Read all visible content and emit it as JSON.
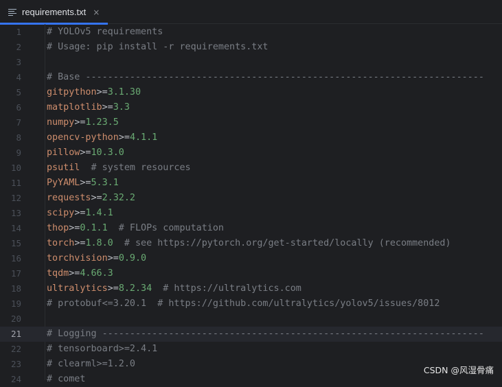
{
  "tab": {
    "filename": "requirements.txt",
    "close_glyph": "×",
    "icon": "text-file-icon"
  },
  "current_line": 21,
  "lines": [
    {
      "n": "1",
      "parts": [
        {
          "t": "cm",
          "v": "# YOLOv5 requirements"
        }
      ]
    },
    {
      "n": "2",
      "parts": [
        {
          "t": "cm",
          "v": "# Usage: pip install -r requirements.txt"
        }
      ]
    },
    {
      "n": "3",
      "parts": []
    },
    {
      "n": "4",
      "parts": [
        {
          "t": "cm",
          "v": "# Base ------------------------------------------------------------------------"
        }
      ]
    },
    {
      "n": "5",
      "parts": [
        {
          "t": "pkg",
          "v": "gitpython"
        },
        {
          "t": "op",
          "v": ">="
        },
        {
          "t": "ver",
          "v": "3.1.30"
        }
      ]
    },
    {
      "n": "6",
      "parts": [
        {
          "t": "pkg",
          "v": "matplotlib"
        },
        {
          "t": "op",
          "v": ">="
        },
        {
          "t": "ver",
          "v": "3.3"
        }
      ]
    },
    {
      "n": "7",
      "parts": [
        {
          "t": "pkg",
          "v": "numpy"
        },
        {
          "t": "op",
          "v": ">="
        },
        {
          "t": "ver",
          "v": "1.23.5"
        }
      ]
    },
    {
      "n": "8",
      "parts": [
        {
          "t": "pkg",
          "v": "opencv-python"
        },
        {
          "t": "op",
          "v": ">="
        },
        {
          "t": "ver",
          "v": "4.1.1"
        }
      ]
    },
    {
      "n": "9",
      "parts": [
        {
          "t": "pkg",
          "v": "pillow"
        },
        {
          "t": "op",
          "v": ">="
        },
        {
          "t": "ver",
          "v": "10.3.0"
        }
      ]
    },
    {
      "n": "10",
      "parts": [
        {
          "t": "pkg",
          "v": "psutil"
        },
        {
          "t": "cm",
          "v": "  # system resources"
        }
      ]
    },
    {
      "n": "11",
      "parts": [
        {
          "t": "pkg",
          "v": "PyYAML"
        },
        {
          "t": "op",
          "v": ">="
        },
        {
          "t": "ver",
          "v": "5.3.1"
        }
      ]
    },
    {
      "n": "12",
      "parts": [
        {
          "t": "pkg",
          "v": "requests"
        },
        {
          "t": "op",
          "v": ">="
        },
        {
          "t": "ver",
          "v": "2.32.2"
        }
      ]
    },
    {
      "n": "13",
      "parts": [
        {
          "t": "pkg",
          "v": "scipy"
        },
        {
          "t": "op",
          "v": ">="
        },
        {
          "t": "ver",
          "v": "1.4.1"
        }
      ]
    },
    {
      "n": "14",
      "parts": [
        {
          "t": "pkg",
          "v": "thop"
        },
        {
          "t": "op",
          "v": ">="
        },
        {
          "t": "ver",
          "v": "0.1.1"
        },
        {
          "t": "cm",
          "v": "  # FLOPs computation"
        }
      ]
    },
    {
      "n": "15",
      "parts": [
        {
          "t": "pkg",
          "v": "torch"
        },
        {
          "t": "op",
          "v": ">="
        },
        {
          "t": "ver",
          "v": "1.8.0"
        },
        {
          "t": "cm",
          "v": "  # see https://pytorch.org/get-started/locally (recommended)"
        }
      ]
    },
    {
      "n": "16",
      "parts": [
        {
          "t": "pkg",
          "v": "torchvision"
        },
        {
          "t": "op",
          "v": ">="
        },
        {
          "t": "ver",
          "v": "0.9.0"
        }
      ]
    },
    {
      "n": "17",
      "parts": [
        {
          "t": "pkg",
          "v": "tqdm"
        },
        {
          "t": "op",
          "v": ">="
        },
        {
          "t": "ver",
          "v": "4.66.3"
        }
      ]
    },
    {
      "n": "18",
      "parts": [
        {
          "t": "pkg",
          "v": "ultralytics"
        },
        {
          "t": "op",
          "v": ">="
        },
        {
          "t": "ver",
          "v": "8.2.34"
        },
        {
          "t": "cm",
          "v": "  # https://ultralytics.com"
        }
      ]
    },
    {
      "n": "19",
      "parts": [
        {
          "t": "cm",
          "v": "# protobuf<=3.20.1  # https://github.com/ultralytics/yolov5/issues/8012"
        }
      ]
    },
    {
      "n": "20",
      "parts": []
    },
    {
      "n": "21",
      "parts": [
        {
          "t": "cm",
          "v": "# Logging ---------------------------------------------------------------------"
        }
      ]
    },
    {
      "n": "22",
      "parts": [
        {
          "t": "cm",
          "v": "# tensorboard>=2.4.1"
        }
      ]
    },
    {
      "n": "23",
      "parts": [
        {
          "t": "cm",
          "v": "# clearml>=1.2.0"
        }
      ]
    },
    {
      "n": "24",
      "parts": [
        {
          "t": "cm",
          "v": "# comet"
        }
      ]
    }
  ],
  "watermark": "CSDN @风湿骨痛",
  "colors": {
    "background": "#1e1f22",
    "package": "#cf8e6d",
    "version": "#6aab73",
    "comment": "#7a7e85",
    "operator": "#bcbec4",
    "tab_accent": "#3574f0"
  }
}
